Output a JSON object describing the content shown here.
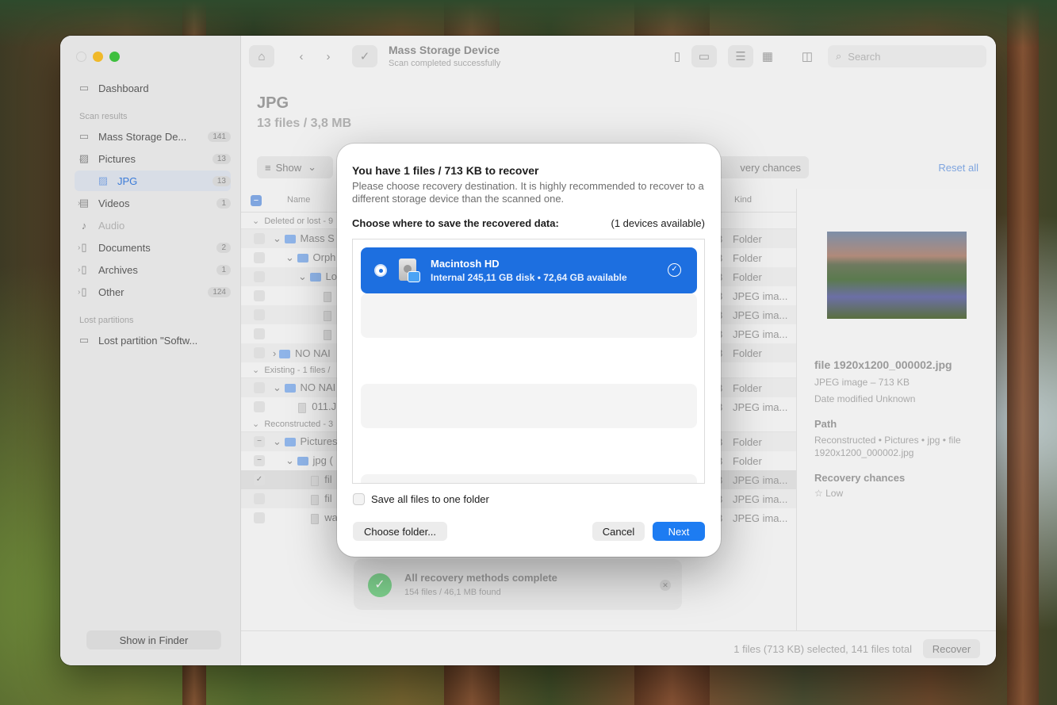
{
  "window": {
    "title": "Mass Storage Device",
    "subtitle": "Scan completed successfully",
    "search_placeholder": "Search"
  },
  "sidebar": {
    "dashboard": "Dashboard",
    "scan_results_label": "Scan results",
    "lost_partitions_label": "Lost partitions",
    "items": [
      {
        "label": "Mass Storage De...",
        "count": "141"
      },
      {
        "label": "Pictures",
        "count": "13"
      },
      {
        "label": "JPG",
        "count": "13"
      },
      {
        "label": "Videos",
        "count": "1"
      },
      {
        "label": "Audio",
        "count": ""
      },
      {
        "label": "Documents",
        "count": "2"
      },
      {
        "label": "Archives",
        "count": "1"
      },
      {
        "label": "Other",
        "count": "124"
      }
    ],
    "lost_partition": "Lost partition \"Softw...",
    "show_in_finder": "Show in Finder"
  },
  "main": {
    "heading": "JPG",
    "subheading": "13 files / 3,8 MB",
    "show_label": "Show",
    "recovery_chances_label": "very chances",
    "reset_all": "Reset all",
    "columns": {
      "name": "Name",
      "kind": "Kind"
    },
    "groups": {
      "deleted": "Deleted or lost - 9",
      "existing": "Existing - 1 files /",
      "reconstructed": "Reconstructed - 3"
    },
    "rows": [
      {
        "name": "Mass S",
        "kind": "Folder"
      },
      {
        "name": "Orph",
        "kind": "Folder"
      },
      {
        "name": "Lo",
        "kind": "Folder"
      },
      {
        "name": "",
        "kind": "JPEG ima..."
      },
      {
        "name": "",
        "kind": "JPEG ima..."
      },
      {
        "name": "",
        "kind": "JPEG ima..."
      },
      {
        "name": "NO NAI",
        "kind": "Folder"
      },
      {
        "name": "NO NAI",
        "kind": "Folder"
      },
      {
        "name": "011.J",
        "kind": "JPEG ima..."
      },
      {
        "name": "Pictures",
        "kind": "Folder"
      },
      {
        "name": "jpg (",
        "kind": "Folder"
      },
      {
        "name": "fil",
        "kind": "JPEG ima..."
      },
      {
        "name": "fil",
        "kind": "JPEG ima..."
      },
      {
        "name": "wa",
        "kind": "JPEG ima..."
      }
    ],
    "status_text": "1 files (713 KB) selected, 141 files total",
    "recover_button": "Recover"
  },
  "detail": {
    "file_name": "file 1920x1200_000002.jpg",
    "file_type": "JPEG image – 713 KB",
    "date_modified": "Date modified  Unknown",
    "path_label": "Path",
    "path_value_1": "Reconstructed • Pictures • jpg • file",
    "path_value_2": " 1920x1200_000002.jpg",
    "recovery_label": "Recovery chances",
    "recovery_value": "Low"
  },
  "toast": {
    "title": "All recovery methods complete",
    "subtitle": "154 files / 46,1 MB found"
  },
  "dialog": {
    "title": "You have 1 files / 713 KB to recover",
    "description": "Please choose recovery destination. It is highly recommended to recover to a different storage device than the scanned one.",
    "choose_label": "Choose where to save the recovered data:",
    "devices_available": "(1 devices available)",
    "device": {
      "name": "Macintosh HD",
      "info": "Internal 245,11 GB disk • 72,64 GB available"
    },
    "save_to_one_folder": "Save all files to one folder",
    "choose_folder_button": "Choose folder...",
    "cancel_button": "Cancel",
    "next_button": "Next",
    "accent_color": "#1d6fe0"
  }
}
